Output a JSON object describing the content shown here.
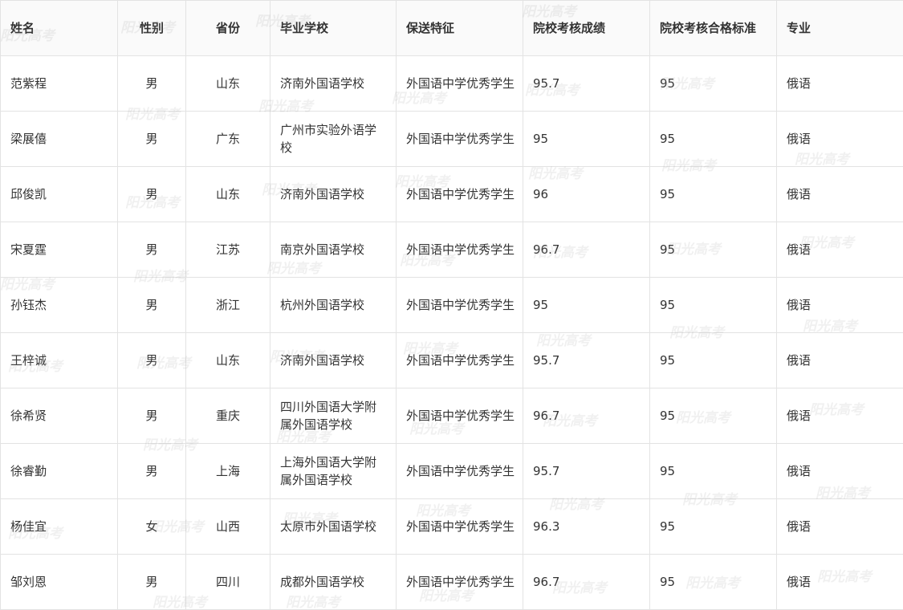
{
  "table": {
    "headers": [
      "姓名",
      "性别",
      "省份",
      "毕业学校",
      "保送特征",
      "院校考核成绩",
      "院校考核合格标准",
      "专业"
    ],
    "rows": [
      [
        "范紫程",
        "男",
        "山东",
        "济南外国语学校",
        "外国语中学优秀学生",
        "95.7",
        "95",
        "俄语"
      ],
      [
        "梁展僖",
        "男",
        "广东",
        "广州市实验外语学校",
        "外国语中学优秀学生",
        "95",
        "95",
        "俄语"
      ],
      [
        "邱俊凯",
        "男",
        "山东",
        "济南外国语学校",
        "外国语中学优秀学生",
        "96",
        "95",
        "俄语"
      ],
      [
        "宋夏霆",
        "男",
        "江苏",
        "南京外国语学校",
        "外国语中学优秀学生",
        "96.7",
        "95",
        "俄语"
      ],
      [
        "孙钰杰",
        "男",
        "浙江",
        "杭州外国语学校",
        "外国语中学优秀学生",
        "95",
        "95",
        "俄语"
      ],
      [
        "王梓诚",
        "男",
        "山东",
        "济南外国语学校",
        "外国语中学优秀学生",
        "95.7",
        "95",
        "俄语"
      ],
      [
        "徐希贤",
        "男",
        "重庆",
        "四川外国语大学附属外国语学校",
        "外国语中学优秀学生",
        "96.7",
        "95",
        "俄语"
      ],
      [
        "徐睿勤",
        "男",
        "上海",
        "上海外国语大学附属外国语学校",
        "外国语中学优秀学生",
        "95.7",
        "95",
        "俄语"
      ],
      [
        "杨佳宜",
        "女",
        "山西",
        "太原市外国语学校",
        "外国语中学优秀学生",
        "96.3",
        "95",
        "俄语"
      ],
      [
        "邹刘恩",
        "男",
        "四川",
        "成都外国语学校",
        "外国语中学优秀学生",
        "96.7",
        "95",
        "俄语"
      ]
    ]
  },
  "watermark": {
    "text": "阳光高考"
  }
}
